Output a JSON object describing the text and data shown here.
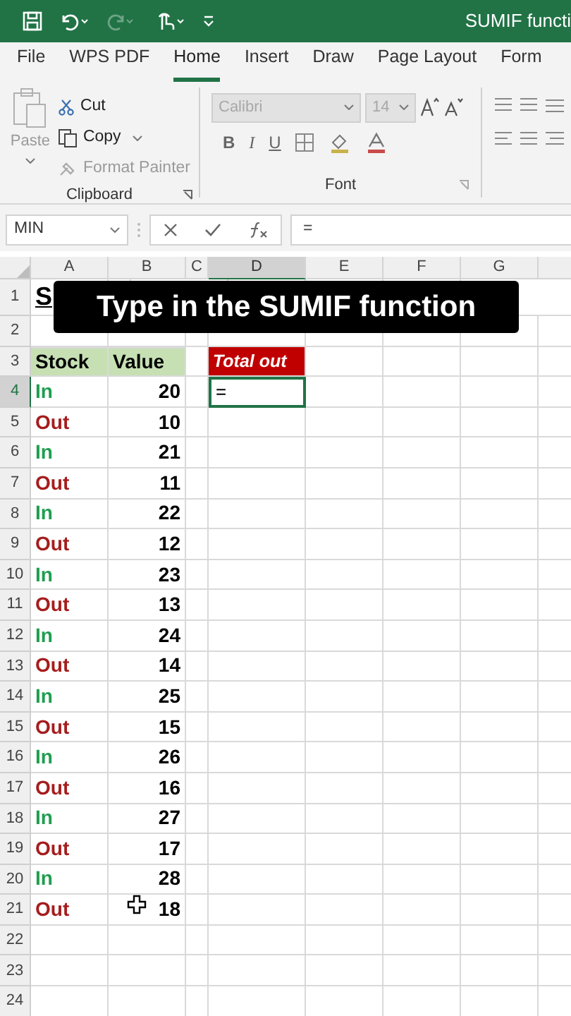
{
  "title_bar": {
    "title": "SUMIF functi"
  },
  "ribbon_tabs": [
    {
      "label": "File",
      "selected": false
    },
    {
      "label": "WPS PDF",
      "selected": false
    },
    {
      "label": "Home",
      "selected": true
    },
    {
      "label": "Insert",
      "selected": false
    },
    {
      "label": "Draw",
      "selected": false
    },
    {
      "label": "Page Layout",
      "selected": false
    },
    {
      "label": "Form",
      "selected": false
    }
  ],
  "clipboard": {
    "label": "Clipboard",
    "items": [
      {
        "kind": "paste",
        "label": "Paste",
        "disabled": true
      },
      {
        "kind": "cut",
        "label": "Cut",
        "disabled": false
      },
      {
        "kind": "copy",
        "label": "Copy",
        "disabled": false
      },
      {
        "kind": "painter",
        "label": "Format Painter",
        "disabled": true
      }
    ]
  },
  "font": {
    "label": "Font",
    "name": {
      "value": "Calibri",
      "disabled": true
    },
    "size": {
      "value": "14",
      "disabled": true
    },
    "styles": [
      "B",
      "I",
      "U"
    ]
  },
  "formula_bar": {
    "name_box": "MIN",
    "formula": "="
  },
  "columns": [
    {
      "label": "A",
      "selected": false
    },
    {
      "label": "B",
      "selected": false
    },
    {
      "label": "C",
      "selected": false
    },
    {
      "label": "D",
      "selected": true
    },
    {
      "label": "E",
      "selected": false
    },
    {
      "label": "F",
      "selected": false
    },
    {
      "label": "G",
      "selected": false
    }
  ],
  "row_numbers": [
    {
      "label": "1",
      "selected": false
    },
    {
      "label": "2",
      "selected": false
    },
    {
      "label": "3",
      "selected": false
    },
    {
      "label": "4",
      "selected": true
    },
    {
      "label": "5",
      "selected": false
    },
    {
      "label": "6",
      "selected": false
    },
    {
      "label": "7",
      "selected": false
    },
    {
      "label": "8",
      "selected": false
    },
    {
      "label": "9",
      "selected": false
    },
    {
      "label": "10",
      "selected": false
    },
    {
      "label": "11",
      "selected": false
    },
    {
      "label": "12",
      "selected": false
    },
    {
      "label": "13",
      "selected": false
    },
    {
      "label": "14",
      "selected": false
    },
    {
      "label": "15",
      "selected": false
    },
    {
      "label": "16",
      "selected": false
    },
    {
      "label": "17",
      "selected": false
    },
    {
      "label": "18",
      "selected": false
    },
    {
      "label": "19",
      "selected": false
    },
    {
      "label": "20",
      "selected": false
    },
    {
      "label": "21",
      "selected": false
    },
    {
      "label": "22",
      "selected": false
    },
    {
      "label": "23",
      "selected": false
    },
    {
      "label": "24",
      "selected": false
    }
  ],
  "caption": "Type in the SUMIF function",
  "sheet": {
    "title_cell": "S",
    "headers": [
      "Stock",
      "Value"
    ],
    "total_label": "Total out",
    "active_cell_value": "=",
    "rows": [
      {
        "kind": "in",
        "stock": "In",
        "value": "20"
      },
      {
        "kind": "out",
        "stock": "Out",
        "value": "10"
      },
      {
        "kind": "in",
        "stock": "In",
        "value": "21"
      },
      {
        "kind": "out",
        "stock": "Out",
        "value": "11"
      },
      {
        "kind": "in",
        "stock": "In",
        "value": "22"
      },
      {
        "kind": "out",
        "stock": "Out",
        "value": "12"
      },
      {
        "kind": "in",
        "stock": "In",
        "value": "23"
      },
      {
        "kind": "out",
        "stock": "Out",
        "value": "13"
      },
      {
        "kind": "in",
        "stock": "In",
        "value": "24"
      },
      {
        "kind": "out",
        "stock": "Out",
        "value": "14"
      },
      {
        "kind": "in",
        "stock": "In",
        "value": "25"
      },
      {
        "kind": "out",
        "stock": "Out",
        "value": "15"
      },
      {
        "kind": "in",
        "stock": "In",
        "value": "26"
      },
      {
        "kind": "out",
        "stock": "Out",
        "value": "16"
      },
      {
        "kind": "in",
        "stock": "In",
        "value": "27"
      },
      {
        "kind": "out",
        "stock": "Out",
        "value": "17"
      },
      {
        "kind": "in",
        "stock": "In",
        "value": "28"
      },
      {
        "kind": "out",
        "stock": "Out",
        "value": "18"
      }
    ]
  }
}
